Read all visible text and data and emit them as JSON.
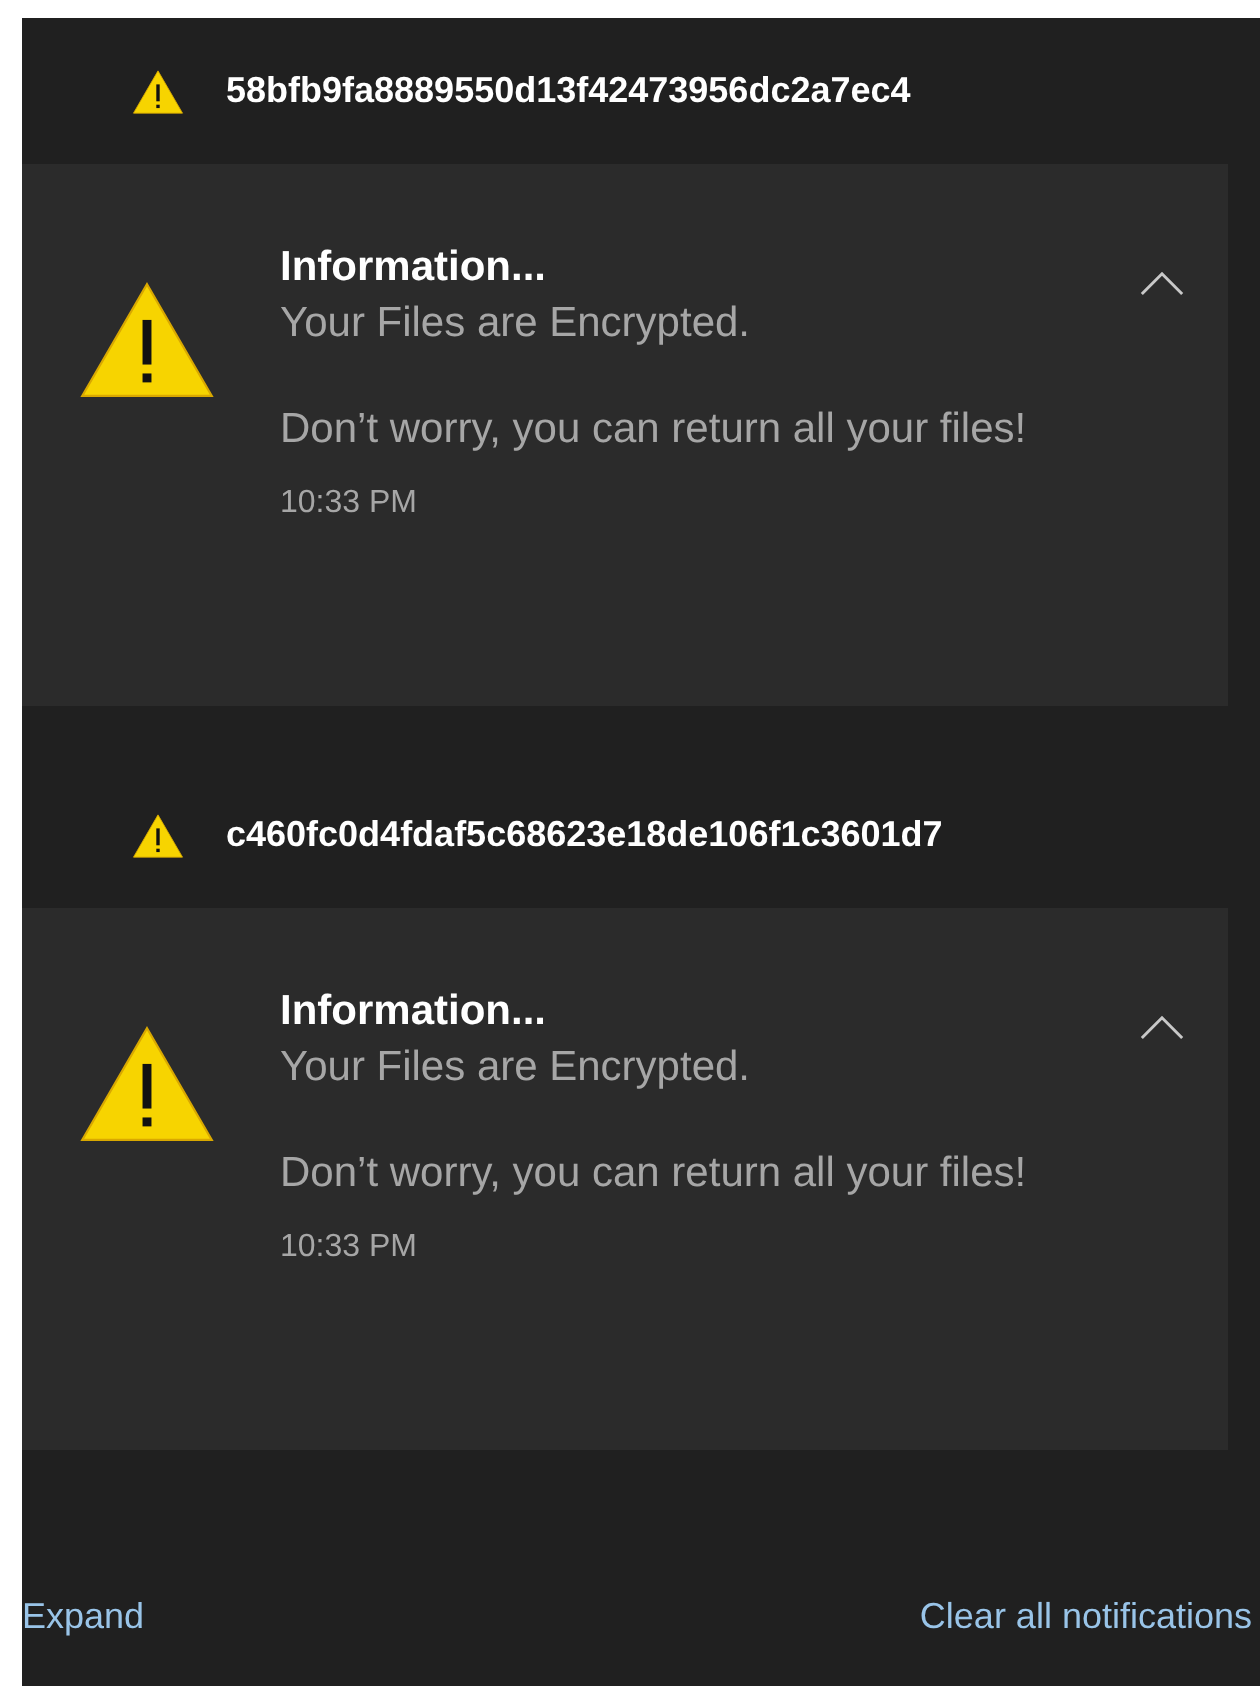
{
  "groups": [
    {
      "app_name": "58bfb9fa8889550d13f42473956dc2a7ec4",
      "notification": {
        "title": "Information...",
        "message": "Your Files are Encrypted.",
        "body": "Don’t worry, you can return all your files!",
        "time": "10:33 PM",
        "expanded": true
      }
    },
    {
      "app_name": "c460fc0d4fdaf5c68623e18de106f1c3601d7",
      "notification": {
        "title": "Information...",
        "message": "Your Files are Encrypted.",
        "body": "Don’t worry, you can return all your files!",
        "time": "10:33 PM",
        "expanded": true
      }
    }
  ],
  "footer": {
    "expand": "Expand",
    "clear_all": "Clear all notifications"
  }
}
